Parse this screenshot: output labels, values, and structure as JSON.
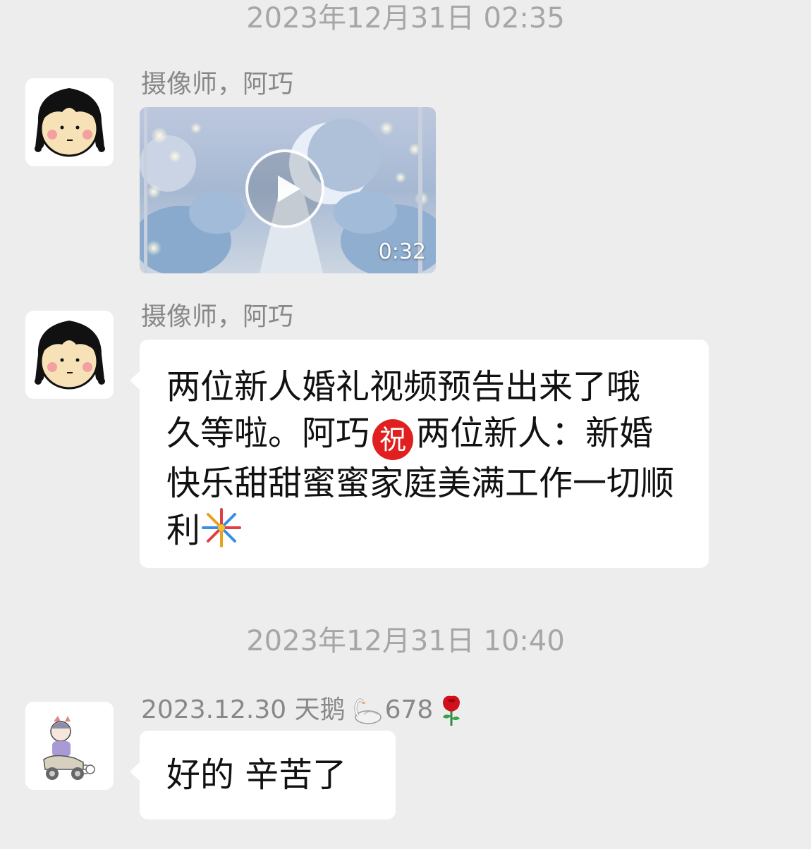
{
  "chat": {
    "timestamps": [
      "2023年12月31日 02:35",
      "2023年12月31日 10:40"
    ],
    "messages": [
      {
        "sender": "摄像师，阿巧",
        "type": "video",
        "duration": "0:32"
      },
      {
        "sender": "摄像师，阿巧",
        "type": "text",
        "segments": [
          "两位新人婚礼视频预告出来了哦  久等啦。阿巧",
          "祝",
          "两位新人：新婚快乐甜甜蜜蜜家庭美满工作一切顺利"
        ],
        "emoji_badge": "congratulations-badge",
        "emoji_end": "fireworks-icon"
      },
      {
        "sender_text": "2023.12.30 天鹅",
        "sender_number": "678",
        "sender_emojis": [
          "swan-icon",
          "rose-icon"
        ],
        "type": "text",
        "text": "好的 辛苦了"
      }
    ]
  },
  "colors": {
    "background": "#ededed",
    "bubble": "#ffffff",
    "timestamp": "#a6a6a6",
    "sender": "#888888",
    "badge": "#e02020"
  }
}
